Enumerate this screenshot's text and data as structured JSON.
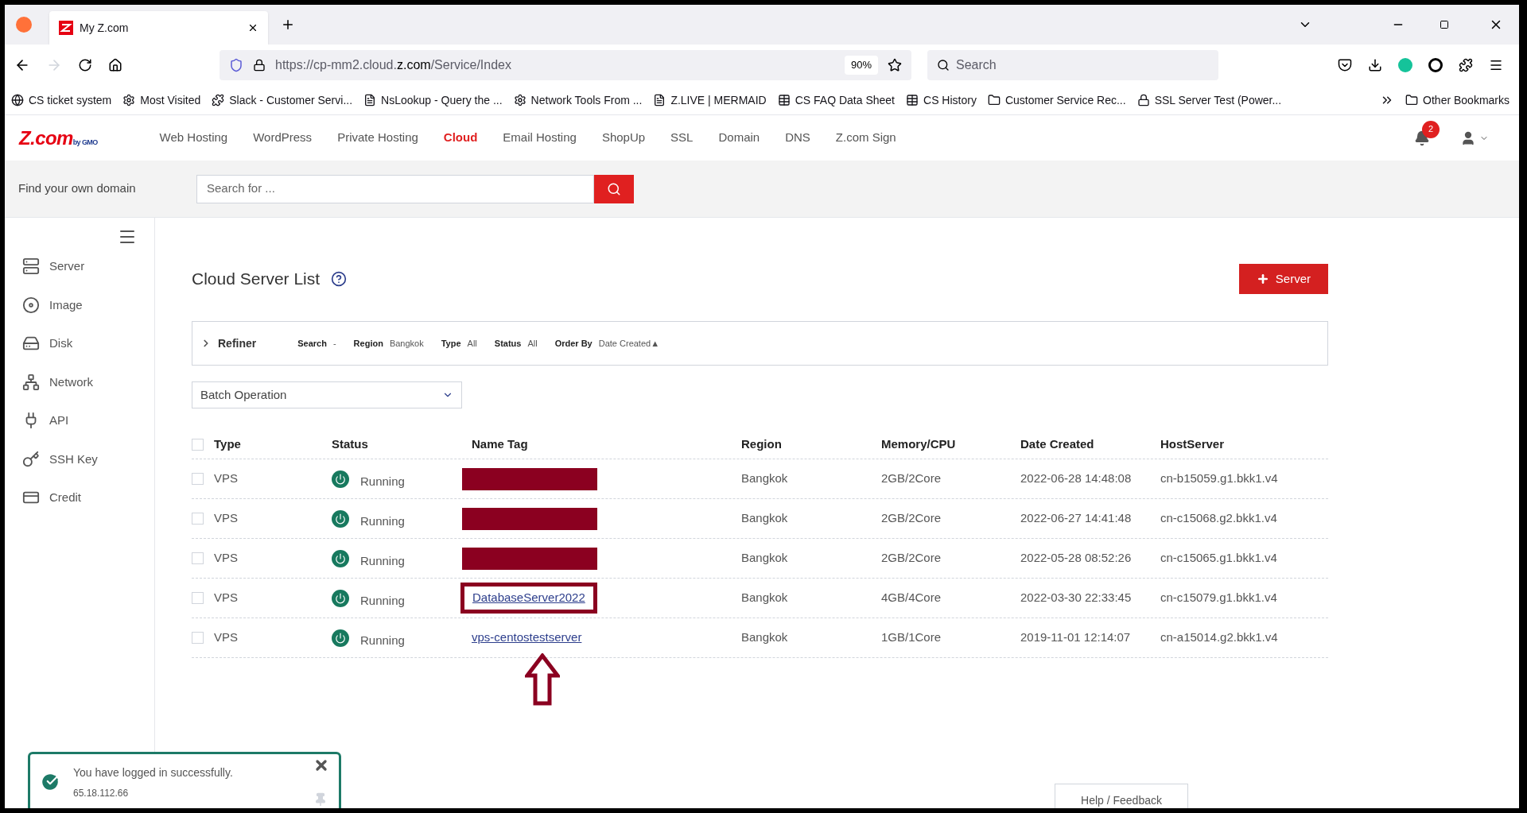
{
  "browser": {
    "tab_title": "My Z.com",
    "url_prefix": "https://cp-mm2.cloud.",
    "url_domain": "z.com",
    "url_path": "/Service/Index",
    "zoom": "90%",
    "search_placeholder": "Search",
    "bookmarks": [
      "CS ticket system",
      "Most Visited",
      "Slack - Customer Servi...",
      "NsLookup - Query the ...",
      "Network Tools From ...",
      "Z.LIVE | MERMAID",
      "CS FAQ Data Sheet",
      "CS History",
      "Customer Service Rec...",
      "SSL Server Test (Power..."
    ],
    "other_bookmarks": "Other Bookmarks"
  },
  "site": {
    "logo_main": "Z.com",
    "logo_sub": "by GMO",
    "nav": [
      {
        "label": "Web Hosting",
        "selected": false
      },
      {
        "label": "WordPress",
        "selected": false
      },
      {
        "label": "Private Hosting",
        "selected": false
      },
      {
        "label": "Cloud",
        "selected": true
      },
      {
        "label": "Email Hosting",
        "selected": false
      },
      {
        "label": "ShopUp",
        "selected": false
      },
      {
        "label": "SSL",
        "selected": false
      },
      {
        "label": "Domain",
        "selected": false
      },
      {
        "label": "DNS",
        "selected": false
      },
      {
        "label": "Z.com Sign",
        "selected": false
      }
    ],
    "notification_count": "2",
    "domain_label": "Find your own domain",
    "domain_placeholder": "Search for ..."
  },
  "sidebar": {
    "items": [
      {
        "label": "Server"
      },
      {
        "label": "Image"
      },
      {
        "label": "Disk"
      },
      {
        "label": "Network"
      },
      {
        "label": "API"
      },
      {
        "label": "SSH Key"
      },
      {
        "label": "Credit"
      }
    ]
  },
  "page": {
    "title": "Cloud Server List",
    "add_button": "Server",
    "refiner": {
      "label": "Refiner",
      "filters": [
        {
          "name": "Search",
          "value": "-"
        },
        {
          "name": "Region",
          "value": "Bangkok"
        },
        {
          "name": "Type",
          "value": "All"
        },
        {
          "name": "Status",
          "value": "All"
        },
        {
          "name": "Order By",
          "value": "Date Created▲"
        }
      ]
    },
    "batch": "Batch Operation",
    "table": {
      "select_all_checked": false,
      "columns": [
        "Type",
        "Status",
        "Name Tag",
        "Region",
        "Memory/CPU",
        "Date Created",
        "HostServer"
      ],
      "rows": [
        {
          "checked": false,
          "type": "VPS",
          "status": "Running",
          "redacted": true,
          "highlighted": false,
          "region": "Bangkok",
          "memory": "2GB/2Core",
          "date": "2022-06-28 14:48:08",
          "host": "cn-b15059.g1.bkk1.v4"
        },
        {
          "checked": false,
          "type": "VPS",
          "status": "Running",
          "redacted": true,
          "highlighted": false,
          "region": "Bangkok",
          "memory": "2GB/2Core",
          "date": "2022-06-27 14:41:48",
          "host": "cn-c15068.g2.bkk1.v4"
        },
        {
          "checked": false,
          "type": "VPS",
          "status": "Running",
          "redacted": true,
          "highlighted": false,
          "region": "Bangkok",
          "memory": "2GB/2Core",
          "date": "2022-05-28 08:52:26",
          "host": "cn-c15065.g1.bkk1.v4"
        },
        {
          "checked": false,
          "type": "VPS",
          "status": "Running",
          "name": "DatabaseServer2022",
          "redacted": false,
          "highlighted": true,
          "region": "Bangkok",
          "memory": "4GB/4Core",
          "date": "2022-03-30 22:33:45",
          "host": "cn-c15079.g1.bkk1.v4"
        },
        {
          "checked": false,
          "type": "VPS",
          "status": "Running",
          "name": "vps-centostestserver",
          "redacted": false,
          "highlighted": false,
          "region": "Bangkok",
          "memory": "1GB/1Core",
          "date": "2019-11-01 12:14:07",
          "host": "cn-a15014.g2.bkk1.v4"
        }
      ]
    }
  },
  "toast": {
    "message": "You have logged in successfully.",
    "ip": "65.18.112.66"
  },
  "help": "Help / Feedback"
}
